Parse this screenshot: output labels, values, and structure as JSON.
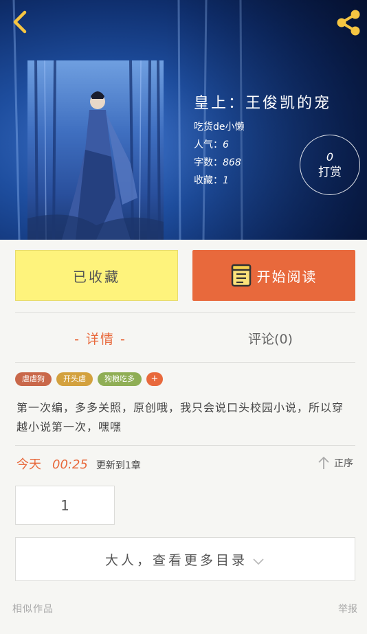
{
  "header": {
    "back_icon": "chevron-left-icon",
    "share_icon": "share-icon"
  },
  "book": {
    "title": "皇上：王俊凯的宠",
    "author": "吃货de小懒",
    "popularity_label": "人气：",
    "popularity": "6",
    "words_label": "字数：",
    "words": "868",
    "favorites_label": "收藏：",
    "favorites": "1"
  },
  "tip": {
    "count": "0",
    "label": "打赏"
  },
  "actions": {
    "collect_label": "已收藏",
    "read_label": "开始阅读",
    "read_icon": "book-icon"
  },
  "tabs": {
    "detail": "- 详情 -",
    "comment": "评论(0)"
  },
  "tags": [
    {
      "label": "虐虐狗",
      "color": "#c9684a"
    },
    {
      "label": "开头虐",
      "color": "#d3a13e"
    },
    {
      "label": "狗粮吃多",
      "color": "#8fae55"
    },
    {
      "label": "+",
      "color": "#e8693c"
    }
  ],
  "description": "第一次编，多多关照，原创哦，我只会说口头校园小说，所以穿越小说第一次，嘿嘿",
  "update": {
    "day": "今天",
    "time": "00:25",
    "text": "更新到1章"
  },
  "sort_label": "正序",
  "chapter": "1",
  "more_catalog": "大人，查看更多目录",
  "footer": {
    "similar": "相似作品",
    "report": "举报"
  },
  "colors": {
    "accent": "#e8693c",
    "collect_bg": "#fef37c",
    "hero_bg": "#1e4e9f"
  }
}
